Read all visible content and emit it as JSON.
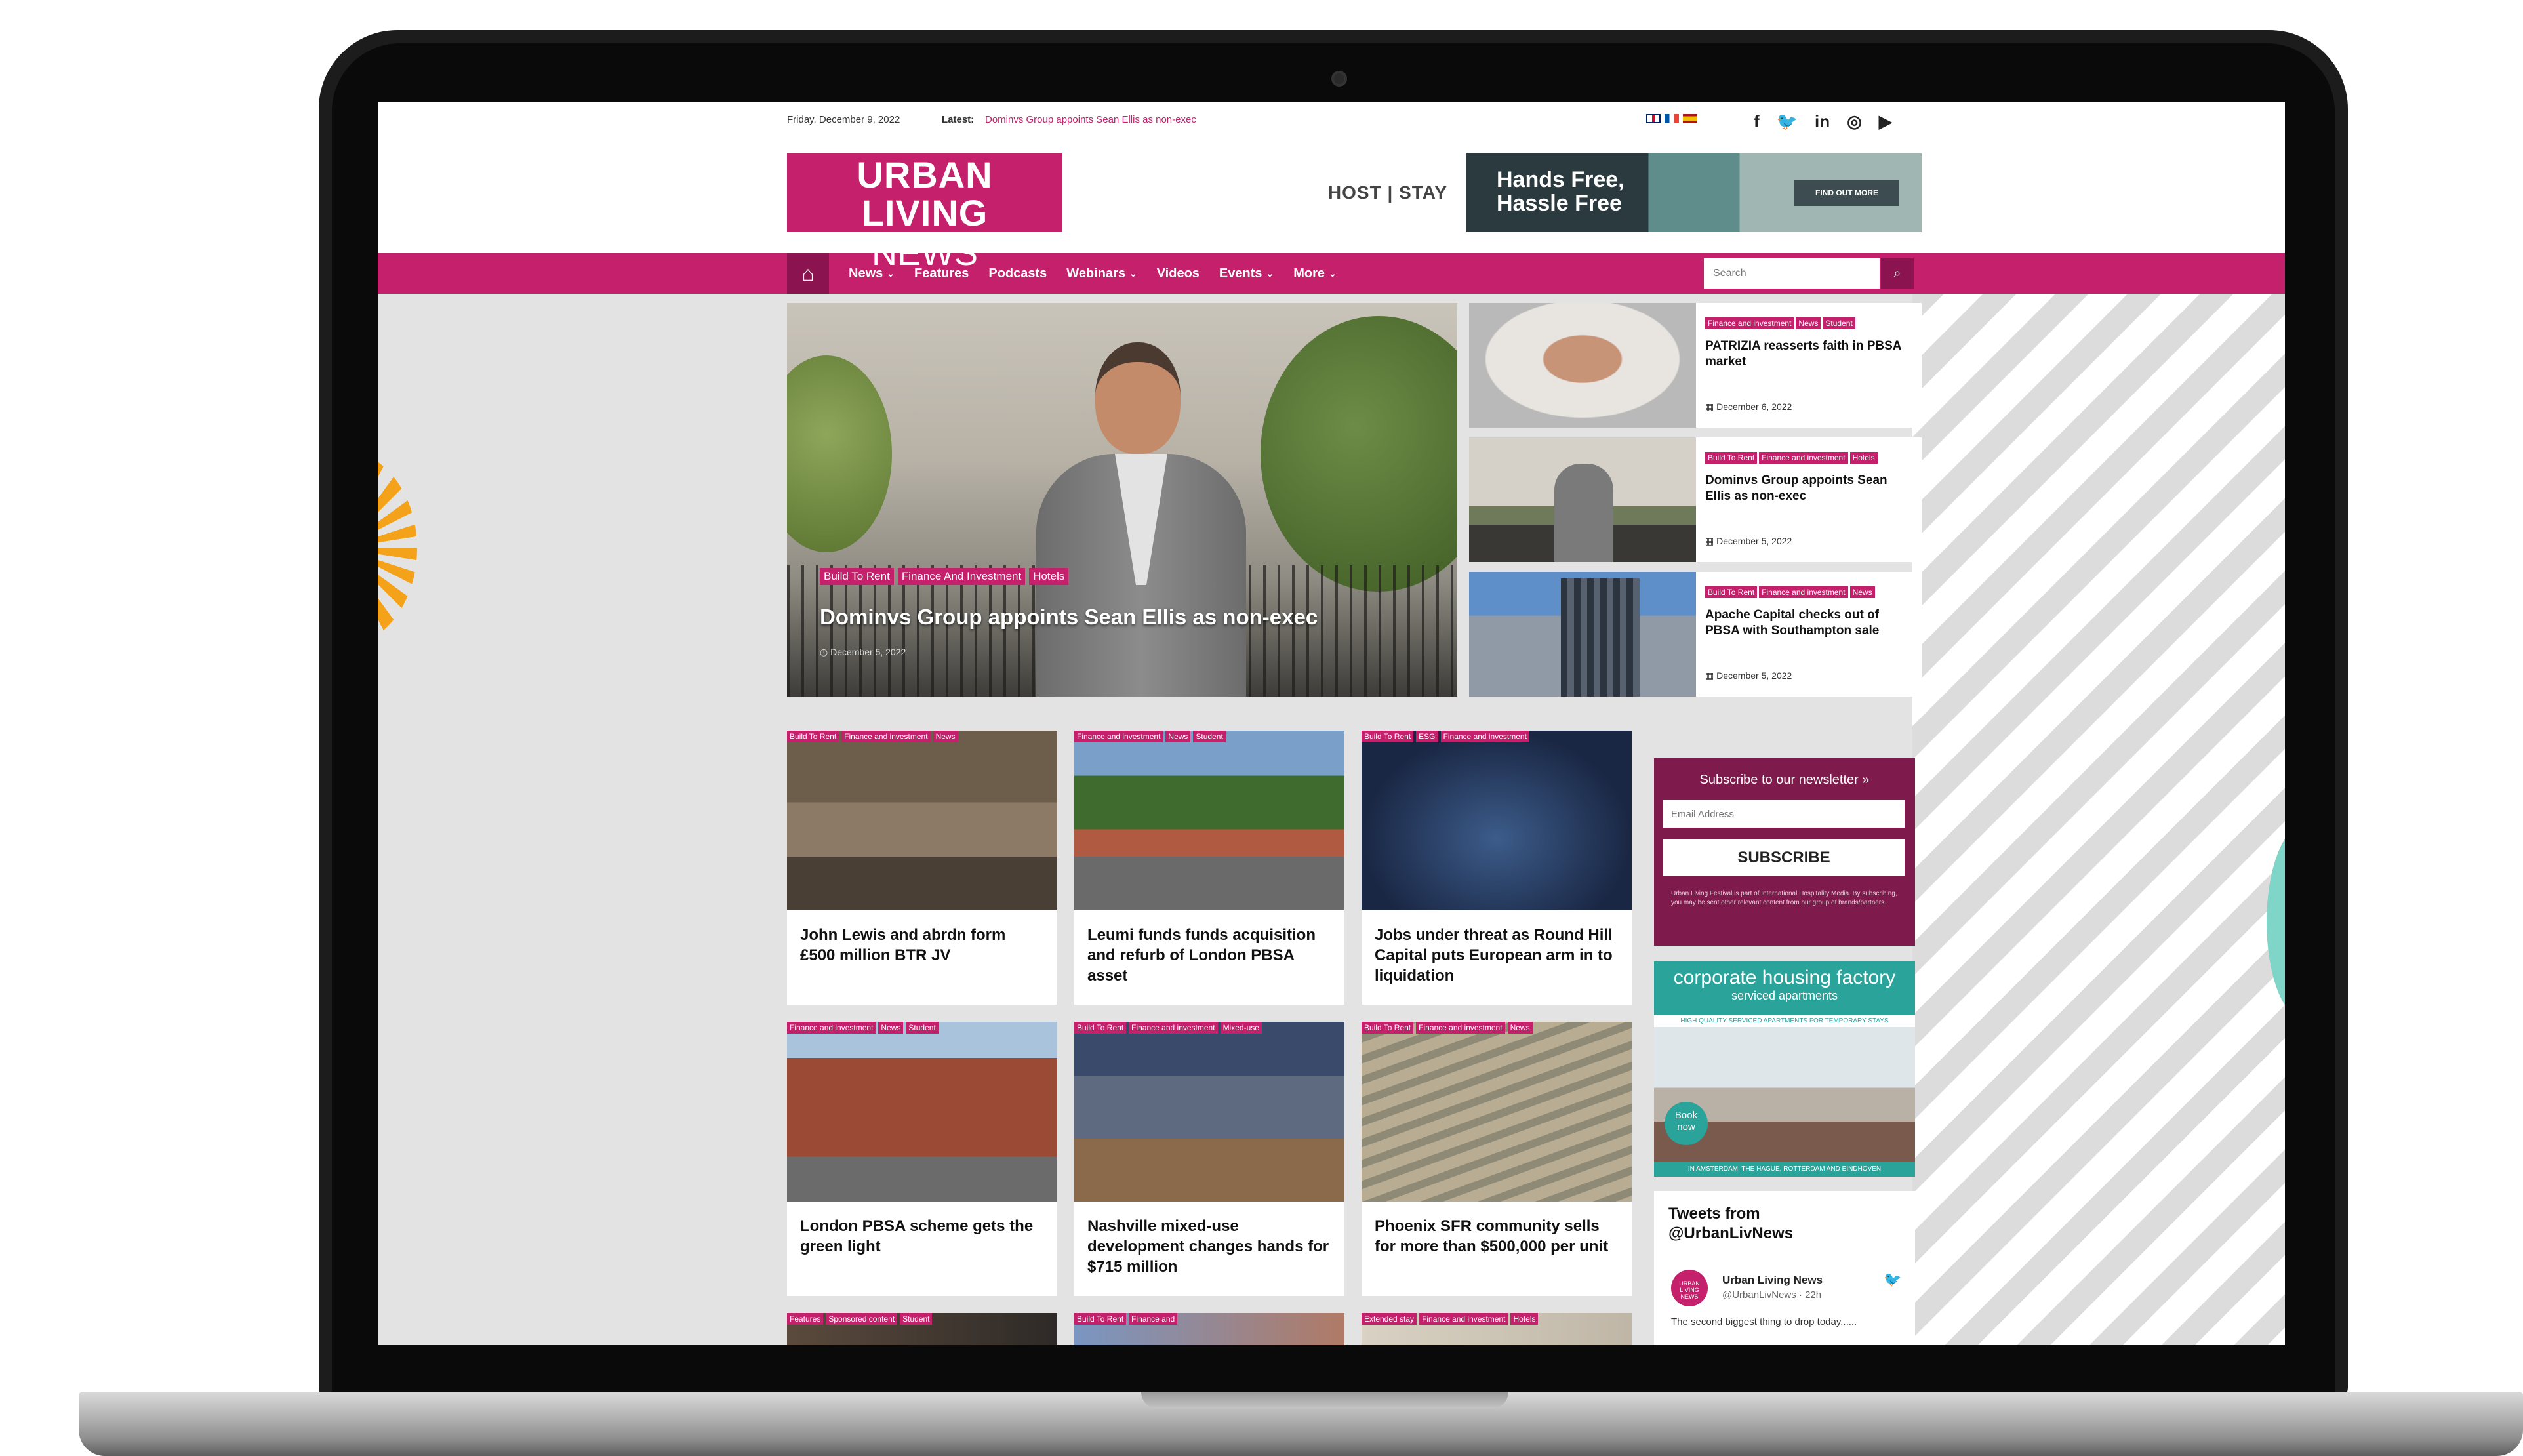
{
  "topbar": {
    "date": "Friday, December 9, 2022",
    "latest_label": "Latest:",
    "latest_link": "Dominvs Group appoints Sean Ellis as non-exec"
  },
  "social_icons": [
    "facebook-icon",
    "twitter-icon",
    "linkedin-icon",
    "instagram-icon",
    "youtube-icon"
  ],
  "social_glyphs": [
    "f",
    "🐦",
    "in",
    "◎",
    "▶"
  ],
  "logo": {
    "line1": "URBAN LIVING",
    "line2": "NEWS"
  },
  "banner": {
    "brand": "HOST | STAY",
    "headline_1": "Hands Free,",
    "headline_2": "Hassle Free",
    "cta": "FIND OUT MORE"
  },
  "nav": {
    "items": [
      {
        "label": "News",
        "dropdown": true
      },
      {
        "label": "Features",
        "dropdown": false
      },
      {
        "label": "Podcasts",
        "dropdown": false
      },
      {
        "label": "Webinars",
        "dropdown": true
      },
      {
        "label": "Videos",
        "dropdown": false
      },
      {
        "label": "Events",
        "dropdown": true
      },
      {
        "label": "More",
        "dropdown": true
      }
    ],
    "search_placeholder": "Search"
  },
  "hero": {
    "tags": [
      "Build To Rent",
      "Finance And Investment",
      "Hotels"
    ],
    "title": "Dominvs Group appoints Sean Ellis as non-exec",
    "date": "December 5, 2022"
  },
  "side_posts": [
    {
      "tags": [
        "Finance and investment",
        "News",
        "Student"
      ],
      "title": "PATRIZIA reasserts faith in PBSA market",
      "date": "December 6, 2022"
    },
    {
      "tags": [
        "Build To Rent",
        "Finance and investment",
        "Hotels"
      ],
      "title": "Dominvs Group appoints Sean Ellis as non-exec",
      "date": "December 5, 2022"
    },
    {
      "tags": [
        "Build To Rent",
        "Finance and investment",
        "News"
      ],
      "title": "Apache Capital checks out of PBSA with Southampton sale",
      "date": "December 5, 2022"
    }
  ],
  "cards": [
    {
      "tags": [
        "Build To Rent",
        "Finance and investment",
        "News"
      ],
      "title": "John Lewis and abrdn form £500 million BTR JV"
    },
    {
      "tags": [
        "Finance and investment",
        "News",
        "Student"
      ],
      "title": "Leumi funds funds acquisition and refurb of London PBSA asset"
    },
    {
      "tags": [
        "Build To Rent",
        "ESG",
        "Finance and investment"
      ],
      "title": "Jobs under threat as Round Hill Capital puts European arm in to liquidation"
    },
    {
      "tags": [
        "Finance and investment",
        "News",
        "Student"
      ],
      "title": "London PBSA scheme gets the green light"
    },
    {
      "tags": [
        "Build To Rent",
        "Finance and investment",
        "Mixed-use"
      ],
      "title": "Nashville mixed-use development changes hands for $715 million"
    },
    {
      "tags": [
        "Build To Rent",
        "Finance and investment",
        "News"
      ],
      "title": "Phoenix SFR community sells for more than $500,000 per unit"
    }
  ],
  "card_stubs": [
    {
      "tags": [
        "Features",
        "Sponsored content",
        "Student"
      ]
    },
    {
      "tags": [
        "Build To Rent",
        "Finance and"
      ]
    },
    {
      "tags": [
        "Extended stay",
        "Finance and investment",
        "Hotels"
      ]
    }
  ],
  "newsletter": {
    "title": "Subscribe to our newsletter »",
    "placeholder": "Email Address",
    "button": "SUBSCRIBE",
    "note": "Urban Living Festival is part of International Hospitality Media. By subscribing, you may be sent other relevant content from our group of brands/partners."
  },
  "ad_sidebar": {
    "title": "corporate housing factory",
    "subtitle": "serviced apartments",
    "strip": "HIGH QUALITY SERVICED APARTMENTS FOR TEMPORARY STAYS",
    "book_1": "Book",
    "book_2": "now",
    "footer": "IN AMSTERDAM, THE HAGUE, ROTTERDAM AND EINDHOVEN"
  },
  "tweets": {
    "title": "Tweets from @UrbanLivNews",
    "avatar_text": "URBAN LIVING NEWS",
    "name": "Urban Living News",
    "handle": "@UrbanLivNews · 22h",
    "text": "The second biggest thing to drop today......"
  },
  "colors": {
    "brand": "#c4206b",
    "brand_dark": "#8b1450",
    "newsletter_bg": "#7e1a4c",
    "teal": "#2aa39a"
  }
}
